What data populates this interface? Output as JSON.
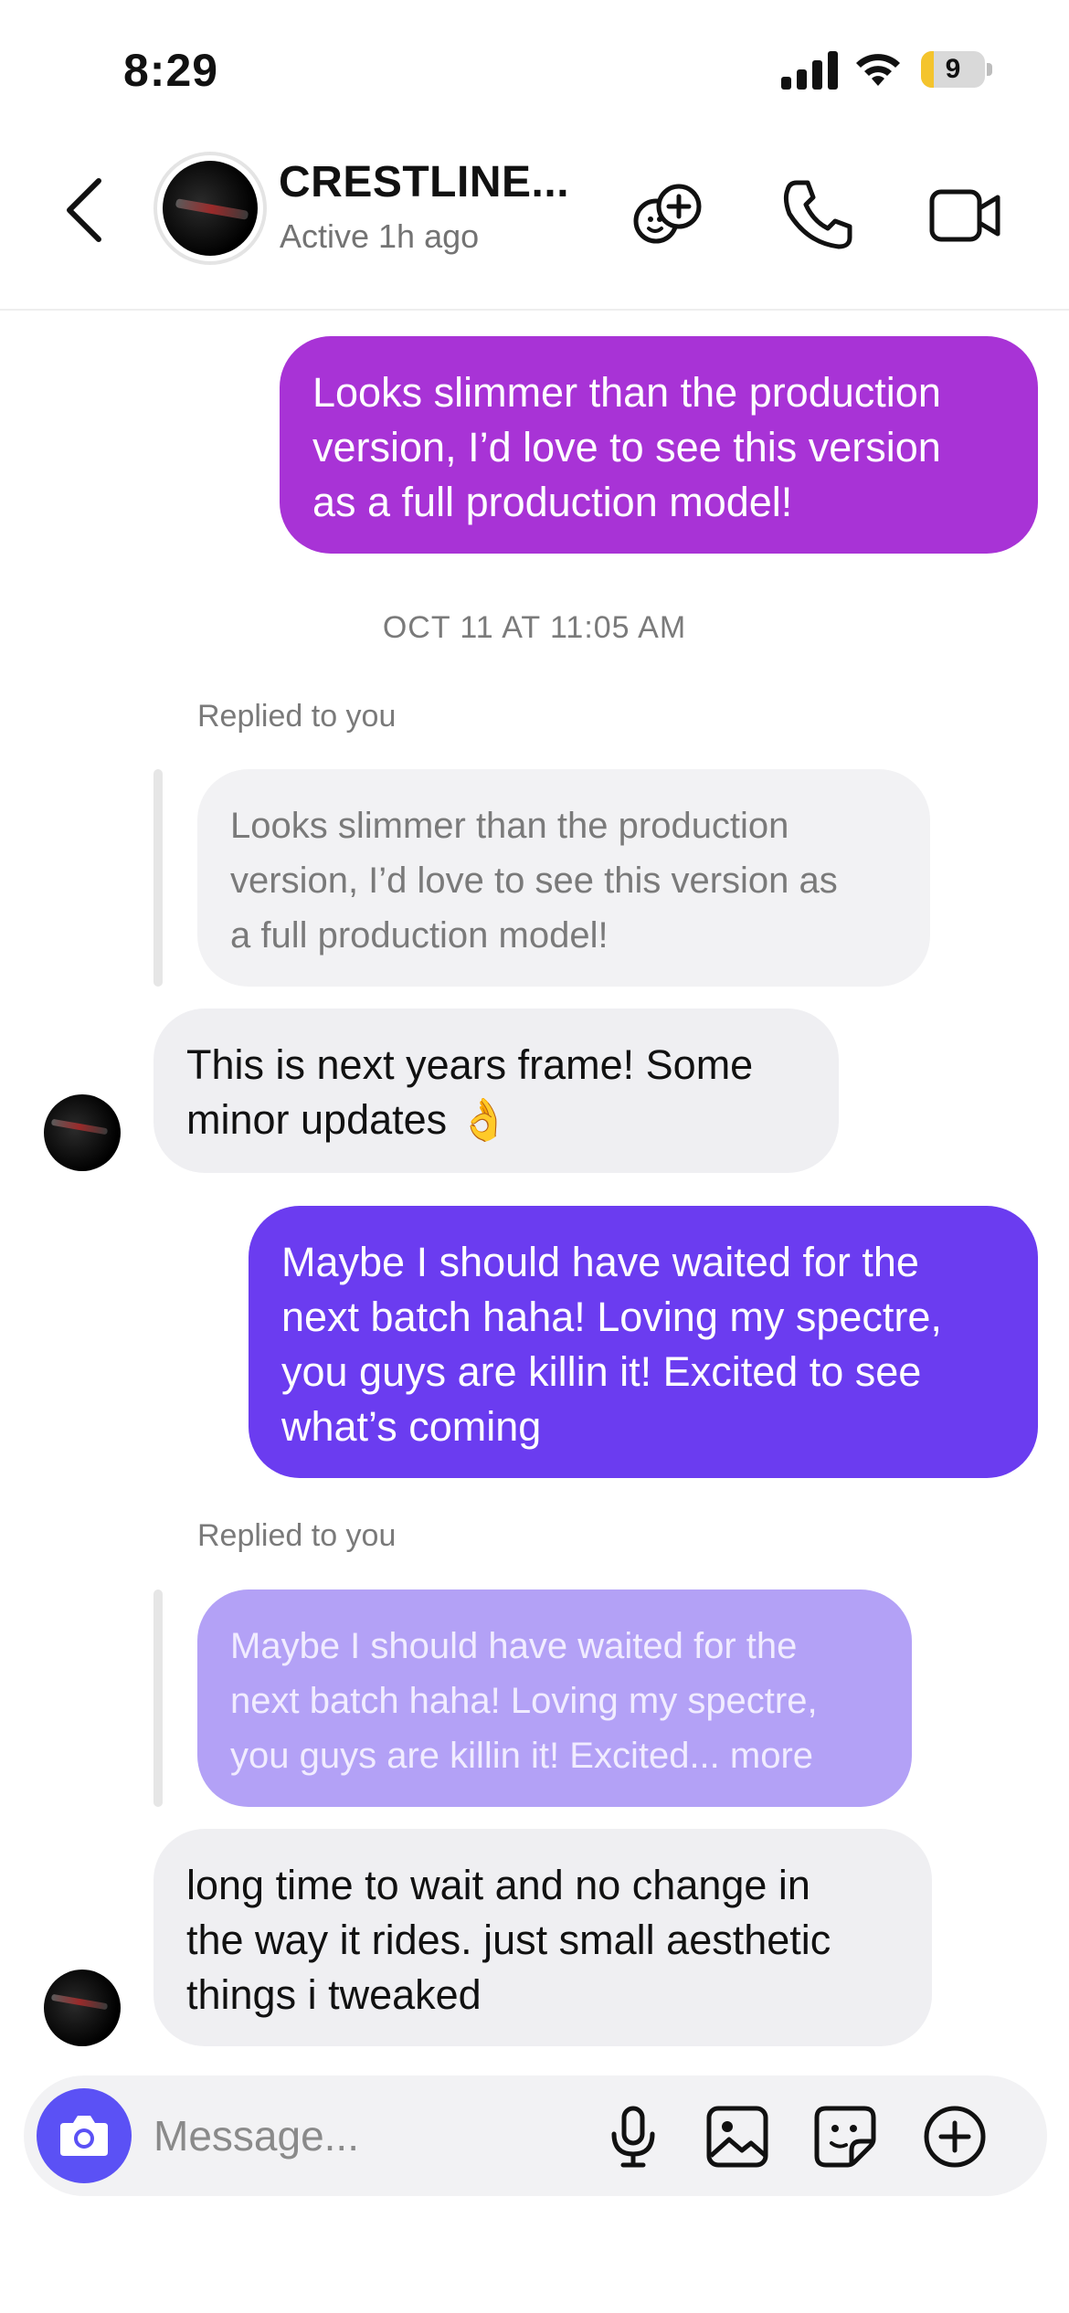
{
  "status_bar": {
    "time": "8:29",
    "battery_level": "9",
    "icons": [
      "signal-icon",
      "wifi-icon",
      "battery-icon"
    ]
  },
  "header": {
    "contact_name": "CRESTLINE...",
    "contact_status": "Active 1h ago",
    "icons": [
      "back-chevron-icon",
      "add-people-icon",
      "phone-icon",
      "video-camera-icon"
    ]
  },
  "messages": [
    {
      "direction": "outgoing",
      "text": "Looks slimmer than the production version, I’d love to see this version as a full production model!",
      "lines": [
        "Looks slimmer than the production",
        "version, I’d love to see this version",
        "as a full production model!"
      ]
    },
    {
      "type": "timestamp",
      "text": "OCT 11 AT 11:05 AM"
    },
    {
      "direction": "incoming",
      "replied_label": "Replied to you",
      "quoted_lines": [
        "Looks slimmer than the production",
        "version, I’d love to see this version as",
        "a full production model!"
      ],
      "lines": [
        "This is next years frame! Some",
        "minor updates 👌"
      ]
    },
    {
      "direction": "outgoing",
      "lines": [
        "Maybe I should have waited for the",
        "next batch haha! Loving my spectre,",
        "you guys are killin it! Excited to see",
        "what’s coming"
      ]
    },
    {
      "direction": "incoming",
      "replied_label": "Replied to you",
      "quoted_lines": [
        "Maybe I should have waited for the",
        "next batch haha! Loving my spectre,",
        "you guys are killin it! Excited... more"
      ],
      "lines": [
        "long time to wait and no change in",
        "the way it rides. just small aesthetic",
        "things i tweaked"
      ]
    }
  ],
  "composer": {
    "placeholder": "Message...",
    "icons": [
      "camera-icon",
      "microphone-icon",
      "gallery-icon",
      "sticker-icon",
      "add-icon"
    ]
  },
  "colors": {
    "outgoing_pink": "#a833d6",
    "outgoing_purple": "#6b3cf0",
    "incoming_bg": "#efeff2",
    "quote_purple": "#b3a1f6",
    "camera_button": "#5b51f5"
  }
}
